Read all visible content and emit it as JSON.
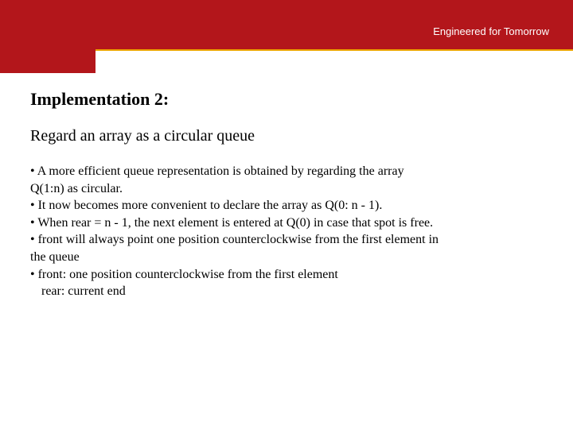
{
  "header": {
    "tagline": "Engineered for Tomorrow"
  },
  "body": {
    "heading": "Implementation 2:",
    "subheading": "Regard an array as a circular queue",
    "lines": [
      "• A more efficient queue representation is obtained by regarding the array",
      "Q(1:n) as circular.",
      "• It now becomes more convenient to declare the array as Q(0: n - 1).",
      "• When rear = n - 1, the next element is entered at Q(0) in case that spot is free.",
      "• front will always point one position counterclockwise from the first element in",
      "the queue",
      "• front:   one position counterclockwise from the first element",
      "rear:    current end"
    ]
  }
}
